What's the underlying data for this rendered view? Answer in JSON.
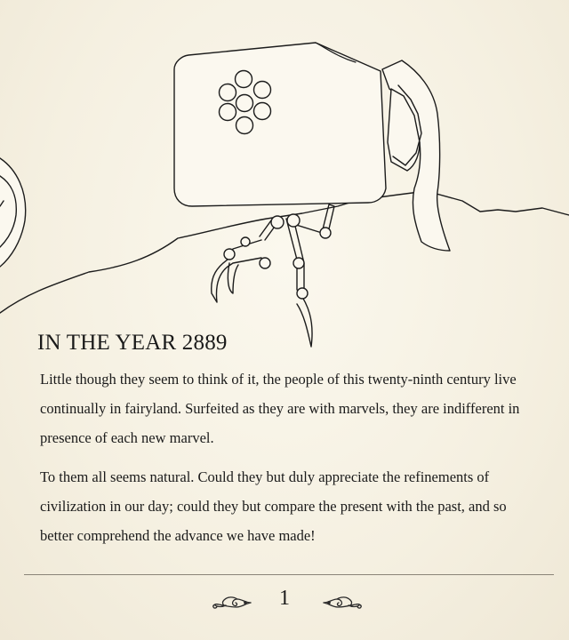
{
  "page": {
    "title": "IN THE YEAR 2889",
    "paragraphs": [
      "Little though they seem to think of it, the people of this twenty-ninth century live continually in fairyland. Surfeited as they are with marvels, they are indifferent in presence of each new marvel.",
      "To them all seems natural. Could they but duly appreciate the refinements of civilization in our day; could they but compare the present with the past, and so better comprehend the advance we have made!"
    ],
    "page_number": "1"
  },
  "illustration": {
    "subject": "robot-creature-line-drawing",
    "stroke_color": "#1c1c1c",
    "fill_color": "#fbf8ef"
  },
  "colors": {
    "paper": "#f5f0e1",
    "text": "#1a1a1a",
    "divider": "#8a8478"
  }
}
